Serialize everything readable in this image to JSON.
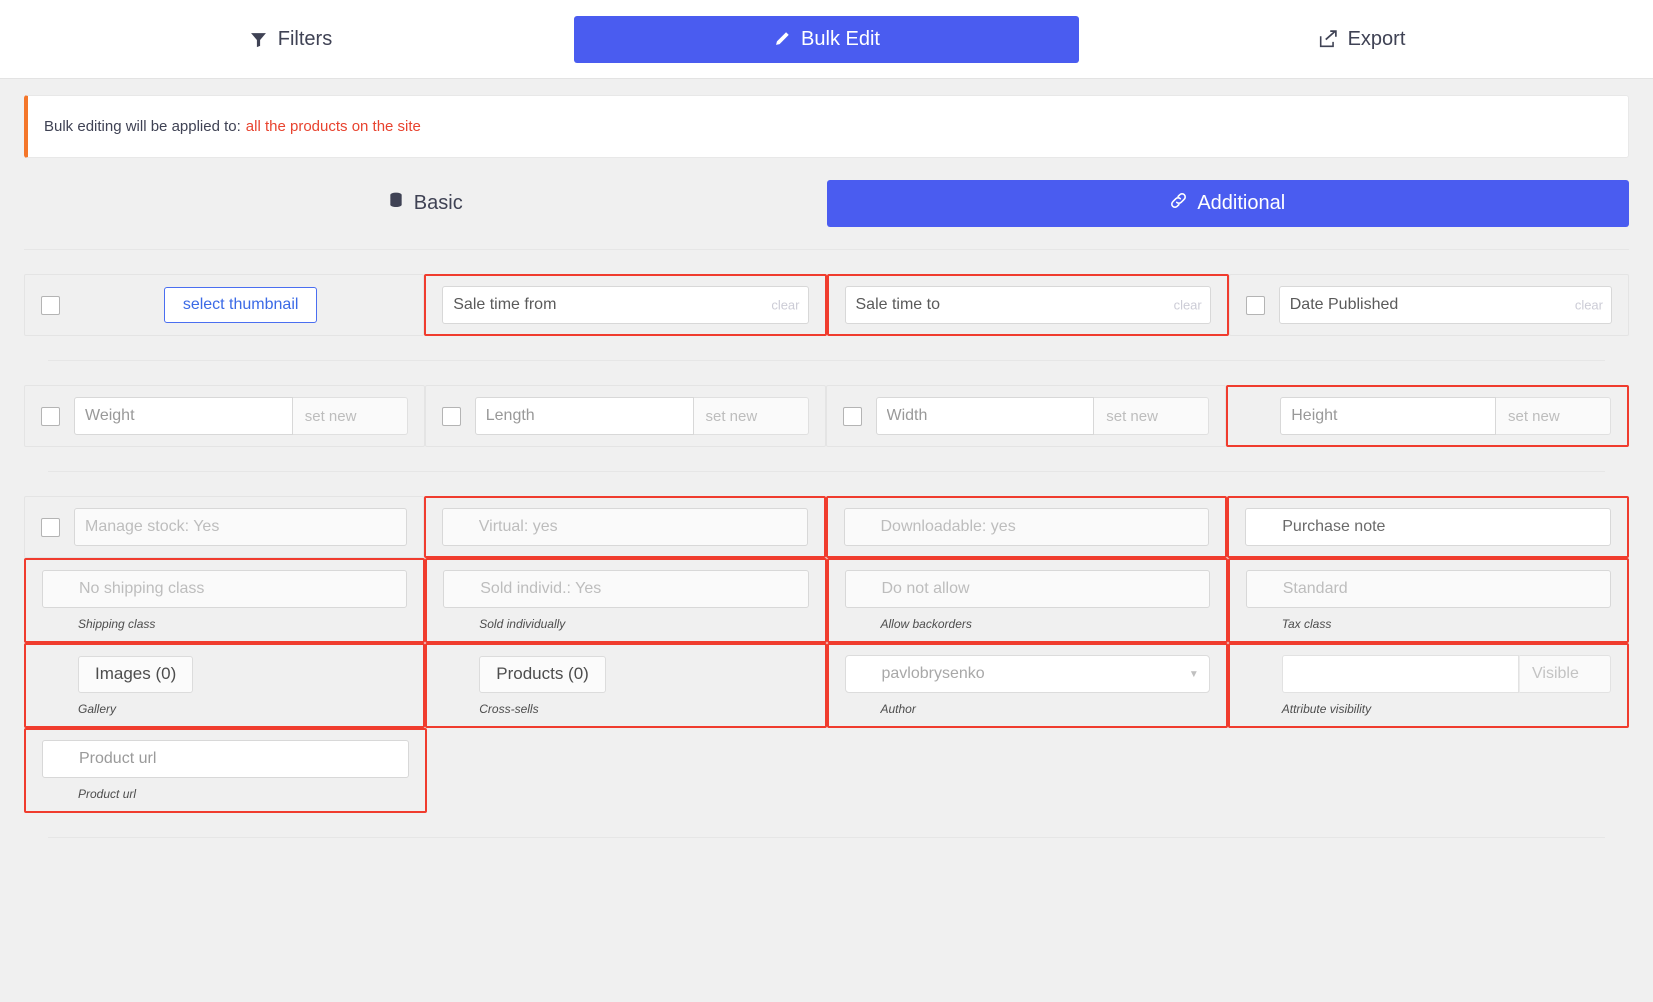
{
  "mode_bar": {
    "tabs": [
      {
        "label": "Filters",
        "icon": "filter-icon",
        "active": false
      },
      {
        "label": "Bulk Edit",
        "icon": "pencil-icon",
        "active": true
      },
      {
        "label": "Export",
        "icon": "export-icon",
        "active": false
      }
    ]
  },
  "notice": {
    "text": "Bulk editing will be applied to:",
    "target": "all the products on the site",
    "accent_color": "#f4762a",
    "target_color": "#e8432f"
  },
  "section_tabs": [
    {
      "label": "Basic",
      "icon": "database-icon",
      "active": false
    },
    {
      "label": "Additional",
      "icon": "link-icon",
      "active": true
    }
  ],
  "rows": {
    "row1": {
      "thumbnail": {
        "button_label": "select thumbnail",
        "checkbox": true
      },
      "sale_time_from": {
        "placeholder": "Sale time from",
        "clear_label": "clear"
      },
      "sale_time_to": {
        "placeholder": "Sale time to",
        "clear_label": "clear"
      },
      "date_published": {
        "placeholder": "Date Published",
        "clear_label": "clear",
        "checkbox": true
      }
    },
    "row2": {
      "weight": {
        "placeholder": "Weight",
        "set_new": "set new"
      },
      "length": {
        "placeholder": "Length",
        "set_new": "set new"
      },
      "width": {
        "placeholder": "Width",
        "set_new": "set new"
      },
      "height": {
        "placeholder": "Height",
        "set_new": "set new"
      }
    },
    "row3": {
      "manage_stock": {
        "value": "Manage stock: Yes"
      },
      "virtual": {
        "value": "Virtual: yes"
      },
      "downloadable": {
        "value": "Downloadable: yes"
      },
      "purchase_note": {
        "placeholder": "Purchase note"
      }
    },
    "row4": {
      "shipping_class": {
        "value": "No shipping class",
        "label": "Shipping class"
      },
      "sold_individually": {
        "value": "Sold individ.: Yes",
        "label": "Sold individually"
      },
      "allow_backorders": {
        "value": "Do not allow",
        "label": "Allow backorders"
      },
      "tax_class": {
        "value": "Standard",
        "label": "Tax class"
      }
    },
    "row5": {
      "gallery": {
        "button_label": "Images (0)",
        "label": "Gallery"
      },
      "cross_sells": {
        "button_label": "Products (0)",
        "label": "Cross-sells"
      },
      "author": {
        "value": "pavlobrysenko",
        "label": "Author"
      },
      "attribute_visibility": {
        "value": "",
        "tag": "Visible",
        "label": "Attribute visibility"
      }
    },
    "row6": {
      "product_url": {
        "placeholder": "Product url",
        "label": "Product url"
      }
    }
  },
  "colors": {
    "accent_blue": "#4a5cf0",
    "alert_red": "#f03c2e",
    "orange": "#f4762a"
  }
}
